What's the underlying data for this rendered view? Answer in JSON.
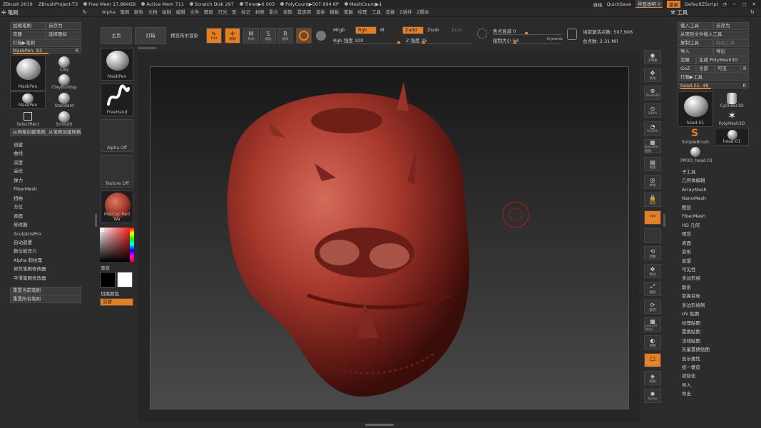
{
  "titlebar": {
    "app": "ZBrush 2019",
    "project": "ZBrushProject-T3",
    "free_mem": "Free Mem 17.884GB",
    "active_mem": "Active Mem 711",
    "scratch": "Scratch Disk 297",
    "timer": "Timer▶0.003",
    "polycount": "PolyCount▶507.904 KP",
    "meshcount": "MeshCount▶1",
    "auto": "自绘",
    "quicksave": "QuickSave",
    "transparency": "界面透明 0",
    "menu": "菜单",
    "script": "DefaultZScript"
  },
  "menubar": {
    "left_title": "笔刷",
    "right_title": "工具",
    "items": [
      "Alpha",
      "笔刷",
      "颜色",
      "文档",
      "绘制",
      "编辑",
      "文件",
      "图层",
      "灯光",
      "宏",
      "标记",
      "材质",
      "影片",
      "拾取",
      "首选项",
      "渲染",
      "模板",
      "笔触",
      "纹理",
      "工具",
      "变换",
      "Z插件",
      "Z脚本"
    ]
  },
  "left_panel": {
    "load_brush": "加载笔刷",
    "save_as": "另存为",
    "clone": "克隆",
    "select_icon": "选择图标",
    "lightbox_brush": "灯箱▶笔刷",
    "maskpen_slider": "MaskPen. 83",
    "maskpen_slider_right": "R",
    "brushes": [
      "MaskPen",
      "Clay",
      "ClayBuildup",
      "MaskPen",
      "Standard",
      "SelectRect",
      "Smooth"
    ],
    "create_from_mesh": "从网格创建笔刷",
    "create_from_brush": "从笔刷创建网格",
    "menu_items": [
      "创建",
      "曲线",
      "深度",
      "采样",
      "弹力",
      "FiberMesh",
      "扭曲",
      "方位",
      "表面",
      "修改器",
      "SculptrisPro",
      "自动遮罩",
      "数位板压力",
      "Alpha 和纹理",
      "修剪笔刷修改器",
      "平滑笔刷修改器"
    ],
    "reset_current": "重置当前笔刷",
    "reset_all": "重置所有笔刷"
  },
  "left_strip": {
    "maskpen": "MaskPen",
    "freehand": "FreeHand",
    "alpha_off": "Alpha Off",
    "texture_off": "Texture Off",
    "matcap": "MatCap Red Wa",
    "gradient": "渐变",
    "switch_color": "切换颜色",
    "alternate": "交替"
  },
  "shelf": {
    "home": "主页",
    "lightbox": "灯箱",
    "preview_render": "预览布尔渲染",
    "edit": "Edit",
    "draw": "绘制",
    "move": "移动",
    "scale": "缩放",
    "rotate": "旋转",
    "mrgb": "Mrgb",
    "rgb": "Rgb",
    "m": "M",
    "rgb_intensity": "Rgb 强度 100",
    "zadd": "Zadd",
    "zsub": "Zsub",
    "zcut": "Zcut",
    "z_intensity": "Z 强度 25",
    "focal_shift": "焦点衰减 0",
    "draw_size": "绘制大小 64",
    "dynamic": "Dynamic",
    "active_points": "当前激活点数: 507,906",
    "total_points": "总点数: 2.31 Mil"
  },
  "right_strip": [
    "子像素",
    "滚动",
    "Zoom2D",
    "100%",
    "AC50%",
    "Dynamic\n透视",
    "地面",
    "本地",
    "锁定",
    "Qxyz",
    "",
    "调整",
    "移动",
    "缩放",
    "旋转",
    "Line Fill\nPolyF",
    "透明",
    "Dynamic",
    "隔离",
    "Xpose"
  ],
  "right_panel": {
    "load_tool": "载入工具",
    "save_as": "另存为",
    "load_from_project": "从项目文件载入工具",
    "copy_tool": "复制工具",
    "paste_tool": "粘贴工具",
    "import": "导入",
    "export": "导出",
    "clone": "克隆",
    "make_polymesh": "生成 PolyMesh3D",
    "goz": "GoZ",
    "all": "全部",
    "visible": "可见",
    "r": "R",
    "lightbox_tool": "灯箱▶工具",
    "head_slider": "head-01. 48",
    "tools": [
      "head-01",
      "Cylinder3D",
      "PolyMesh3D",
      "SimpleBrush",
      "head-01",
      "PM3D_head-01"
    ],
    "menu_items": [
      "子工具",
      "几何体编辑",
      "ArrayMesh",
      "NanoMesh",
      "图层",
      "FiberMesh",
      "HD 几何",
      "预览",
      "表面",
      "变形",
      "遮罩",
      "可见性",
      "多边形组",
      "联系",
      "变换目标",
      "多边形绘制",
      "UV 贴图",
      "纹理贴图",
      "置换贴图",
      "法线贴图",
      "矢量置换贴图",
      "显示属性",
      "统一蒙皮",
      "初始化",
      "导入",
      "导出"
    ]
  },
  "colors": {
    "accent": "#e67e22",
    "model": "#b5453a"
  },
  "sliders": {
    "maskpen": 0.83,
    "head": 0.48,
    "rgb_intensity": 1.0,
    "z_intensity": 0.25,
    "focal_shift": 0.5,
    "draw_size": 0.32
  }
}
